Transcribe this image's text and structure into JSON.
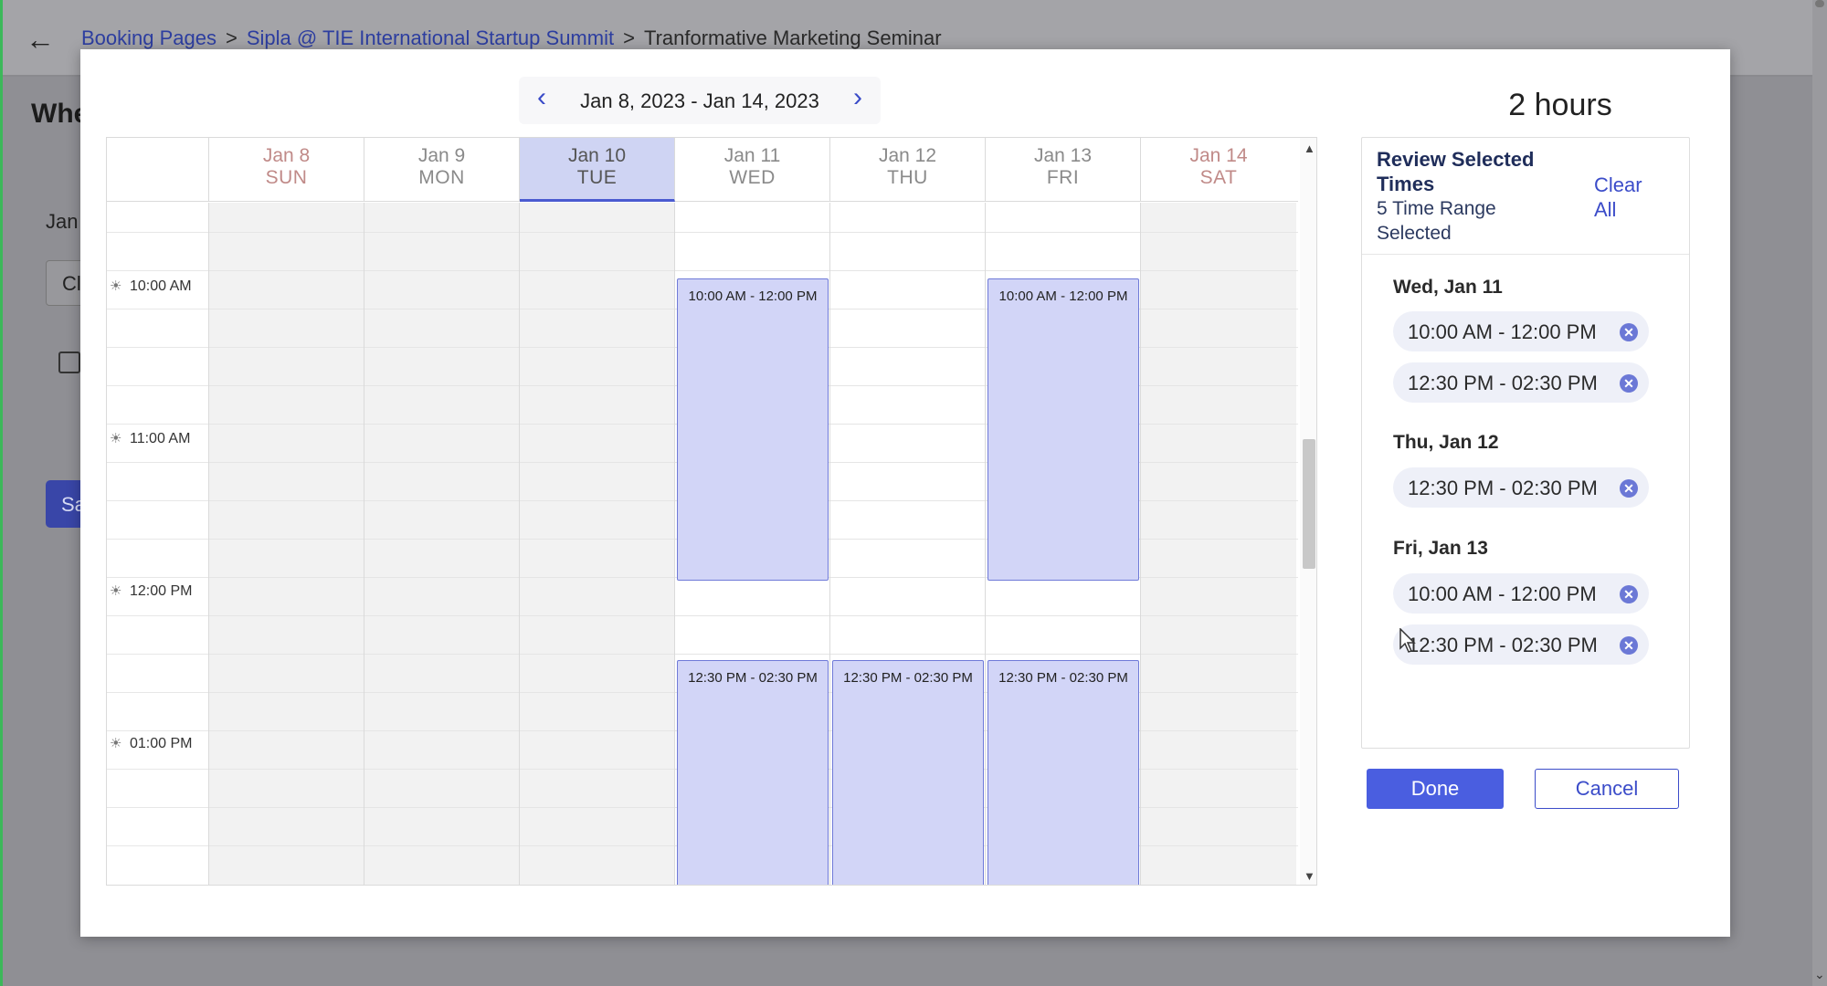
{
  "breadcrumb": {
    "items": [
      "Booking Pages",
      "Sipla @ TIE International Startup Summit",
      "Tranformative Marketing Seminar"
    ],
    "separator": ">"
  },
  "background": {
    "title": "Whe",
    "month_label": "Jan",
    "input_value": "Cl",
    "button_label": "Sa"
  },
  "week_nav": {
    "range_label": "Jan 8, 2023 - Jan 14, 2023"
  },
  "days": [
    {
      "date": "Jan 8",
      "dow": "SUN"
    },
    {
      "date": "Jan 9",
      "dow": "MON"
    },
    {
      "date": "Jan 10",
      "dow": "TUE"
    },
    {
      "date": "Jan 11",
      "dow": "WED"
    },
    {
      "date": "Jan 12",
      "dow": "THU"
    },
    {
      "date": "Jan 13",
      "dow": "FRI"
    },
    {
      "date": "Jan 14",
      "dow": "SAT"
    }
  ],
  "time_labels": [
    "10:00 AM",
    "11:00 AM",
    "12:00 PM",
    "01:00 PM"
  ],
  "slots": [
    {
      "day": "Jan 11",
      "label": "10:00 AM - 12:00 PM"
    },
    {
      "day": "Jan 13",
      "label": "10:00 AM - 12:00 PM"
    },
    {
      "day": "Jan 11",
      "label": "12:30 PM - 02:30 PM"
    },
    {
      "day": "Jan 12",
      "label": "12:30 PM - 02:30 PM"
    },
    {
      "day": "Jan 13",
      "label": "12:30 PM - 02:30 PM"
    }
  ],
  "panel": {
    "duration": "2 hours",
    "review_title": "Review Selected Times",
    "count_text": "5 Time Range Selected",
    "clear_all": "Clear All",
    "groups": [
      {
        "title": "Wed, Jan 11",
        "ranges": [
          "10:00 AM - 12:00 PM",
          "12:30 PM - 02:30 PM"
        ]
      },
      {
        "title": "Thu, Jan 12",
        "ranges": [
          "12:30 PM - 02:30 PM"
        ]
      },
      {
        "title": "Fri, Jan 13",
        "ranges": [
          "10:00 AM - 12:00 PM",
          "12:30 PM - 02:30 PM"
        ]
      }
    ],
    "done_label": "Done",
    "cancel_label": "Cancel"
  },
  "colors": {
    "accent": "#4a5ee0",
    "slot_fill": "#d2d5f7",
    "link": "#3b4cc9"
  }
}
